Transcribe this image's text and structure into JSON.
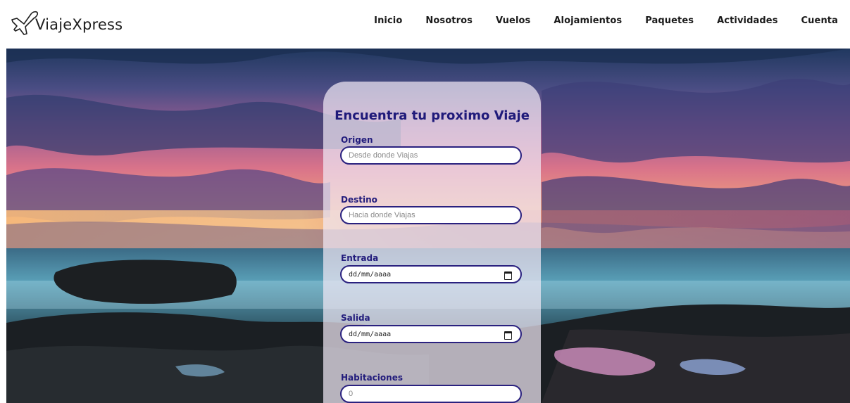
{
  "brand": {
    "name": "ViajeXpress",
    "logo_icon": "airplane-icon"
  },
  "nav": {
    "items": [
      "Inicio",
      "Nosotros",
      "Vuelos",
      "Alojamientos",
      "Paquetes",
      "Actividades",
      "Cuenta"
    ]
  },
  "hero": {
    "background": "sunset-seascape-photo"
  },
  "search": {
    "title": "Encuentra tu proximo Viaje",
    "origen": {
      "label": "Origen",
      "placeholder": "Desde donde Viajas"
    },
    "destino": {
      "label": "Destino",
      "placeholder": "Hacia donde Viajas"
    },
    "entrada": {
      "label": "Entrada",
      "value": "dd/mm/aaaa",
      "icon": "calendar-icon"
    },
    "salida": {
      "label": "Salida",
      "value": "dd/mm/aaaa",
      "icon": "calendar-icon"
    },
    "habitaciones": {
      "label": "Habitaciones",
      "placeholder": "0"
    }
  },
  "colors": {
    "accent": "#2a217f",
    "title": "#1f1a7a",
    "panel": "#f0e8f4"
  }
}
